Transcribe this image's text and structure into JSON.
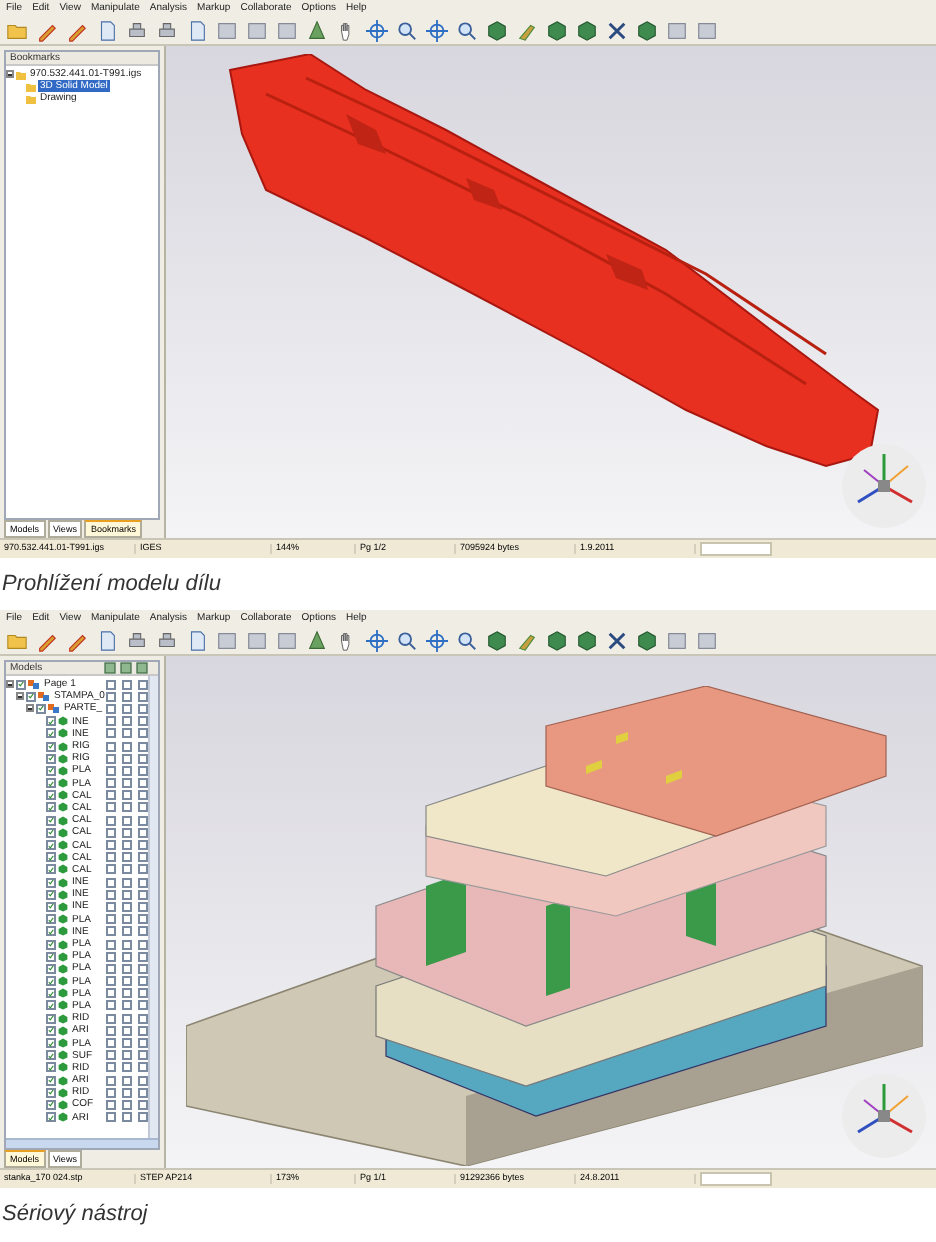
{
  "window_1": {
    "menu": [
      "File",
      "Edit",
      "View",
      "Manipulate",
      "Analysis",
      "Markup",
      "Collaborate",
      "Options",
      "Help"
    ],
    "panel": {
      "title": "Bookmarks",
      "tree": [
        {
          "label": "970.532.441.01-T991.igs",
          "expanded": true,
          "selected": false,
          "children": [
            {
              "label": "3D Solid Model",
              "selected": true
            },
            {
              "label": "Drawing",
              "selected": false
            }
          ]
        }
      ]
    },
    "tabs": [
      {
        "label": "Models",
        "selected": false
      },
      {
        "label": "Views",
        "selected": false
      },
      {
        "label": "Bookmarks",
        "selected": true
      }
    ],
    "status_bar": [
      "970.532.441.01-T991.igs",
      "IGES",
      "144%",
      "Pg 1/2",
      "7095924 bytes",
      "1.9.2011"
    ]
  },
  "caption_1": "Prohlížení modelu dílu",
  "window_2": {
    "menu": [
      "File",
      "Edit",
      "View",
      "Manipulate",
      "Analysis",
      "Markup",
      "Collaborate",
      "Options",
      "Help"
    ],
    "panel": {
      "title": "Models",
      "tree": [
        {
          "label": "Page 1",
          "expanded": true,
          "checked": true,
          "columns": [
            false,
            false,
            false
          ],
          "children": [
            {
              "label": "STAMPA_0",
              "expanded": true,
              "checked": true,
              "columns": [
                false,
                false,
                false
              ],
              "children": [
                {
                  "label": "PARTE_",
                  "expanded": true,
                  "checked": true,
                  "columns": [
                    false,
                    false,
                    false
                  ],
                  "children": [
                    {
                      "label": "INE",
                      "checked": true,
                      "columns": [
                        false,
                        false,
                        false
                      ]
                    },
                    {
                      "label": "INE",
                      "checked": true,
                      "columns": [
                        false,
                        false,
                        false
                      ]
                    },
                    {
                      "label": "RIG",
                      "checked": true,
                      "columns": [
                        false,
                        false,
                        false
                      ]
                    },
                    {
                      "label": "RIG",
                      "checked": true,
                      "columns": [
                        false,
                        false,
                        false
                      ]
                    },
                    {
                      "label": "PLA",
                      "checked": true,
                      "columns": [
                        false,
                        false,
                        false
                      ]
                    },
                    {
                      "label": "PLA",
                      "checked": true,
                      "columns": [
                        false,
                        false,
                        false
                      ]
                    },
                    {
                      "label": "CAL",
                      "checked": true,
                      "columns": [
                        false,
                        false,
                        false
                      ]
                    },
                    {
                      "label": "CAL",
                      "checked": true,
                      "columns": [
                        false,
                        false,
                        false
                      ]
                    },
                    {
                      "label": "CAL",
                      "checked": true,
                      "columns": [
                        false,
                        false,
                        false
                      ]
                    },
                    {
                      "label": "CAL",
                      "checked": true,
                      "columns": [
                        false,
                        false,
                        false
                      ]
                    },
                    {
                      "label": "CAL",
                      "checked": true,
                      "columns": [
                        false,
                        false,
                        false
                      ]
                    },
                    {
                      "label": "CAL",
                      "checked": true,
                      "columns": [
                        false,
                        false,
                        false
                      ]
                    },
                    {
                      "label": "CAL",
                      "checked": true,
                      "columns": [
                        false,
                        false,
                        false
                      ]
                    },
                    {
                      "label": "INE",
                      "checked": true,
                      "columns": [
                        false,
                        false,
                        false
                      ]
                    },
                    {
                      "label": "INE",
                      "checked": true,
                      "columns": [
                        false,
                        false,
                        false
                      ]
                    },
                    {
                      "label": "INE",
                      "checked": true,
                      "columns": [
                        false,
                        false,
                        false
                      ]
                    },
                    {
                      "label": "PLA",
                      "checked": true,
                      "columns": [
                        false,
                        false,
                        false
                      ]
                    },
                    {
                      "label": "INE",
                      "checked": true,
                      "columns": [
                        false,
                        false,
                        false
                      ]
                    },
                    {
                      "label": "PLA",
                      "checked": true,
                      "columns": [
                        false,
                        false,
                        false
                      ]
                    },
                    {
                      "label": "PLA",
                      "checked": true,
                      "columns": [
                        false,
                        false,
                        false
                      ]
                    },
                    {
                      "label": "PLA",
                      "checked": true,
                      "columns": [
                        false,
                        false,
                        false
                      ]
                    },
                    {
                      "label": "PLA",
                      "checked": true,
                      "columns": [
                        false,
                        false,
                        false
                      ]
                    },
                    {
                      "label": "PLA",
                      "checked": true,
                      "columns": [
                        false,
                        false,
                        false
                      ]
                    },
                    {
                      "label": "PLA",
                      "checked": true,
                      "columns": [
                        false,
                        false,
                        false
                      ]
                    },
                    {
                      "label": "RID",
                      "checked": true,
                      "columns": [
                        false,
                        false,
                        false
                      ]
                    },
                    {
                      "label": "ARI",
                      "checked": true,
                      "columns": [
                        false,
                        false,
                        false
                      ]
                    },
                    {
                      "label": "PLA",
                      "checked": true,
                      "columns": [
                        false,
                        false,
                        false
                      ]
                    },
                    {
                      "label": "SUF",
                      "checked": true,
                      "columns": [
                        false,
                        false,
                        false
                      ]
                    },
                    {
                      "label": "RID",
                      "checked": true,
                      "columns": [
                        false,
                        false,
                        false
                      ]
                    },
                    {
                      "label": "ARI",
                      "checked": true,
                      "columns": [
                        false,
                        false,
                        false
                      ]
                    },
                    {
                      "label": "RID",
                      "checked": true,
                      "columns": [
                        false,
                        false,
                        false
                      ]
                    },
                    {
                      "label": "COF",
                      "checked": true,
                      "columns": [
                        false,
                        false,
                        false
                      ]
                    },
                    {
                      "label": "ARI",
                      "checked": true,
                      "columns": [
                        false,
                        false,
                        false
                      ]
                    }
                  ]
                }
              ]
            }
          ]
        }
      ]
    },
    "tabs": [
      {
        "label": "Models",
        "selected": true
      },
      {
        "label": "Views",
        "selected": false
      }
    ],
    "status_bar": [
      "stanka_170 024.stp",
      "STEP AP214",
      "173%",
      "Pg 1/1",
      "91292366 bytes",
      "24.8.2011"
    ]
  },
  "caption_2": "Sériový nástroj"
}
